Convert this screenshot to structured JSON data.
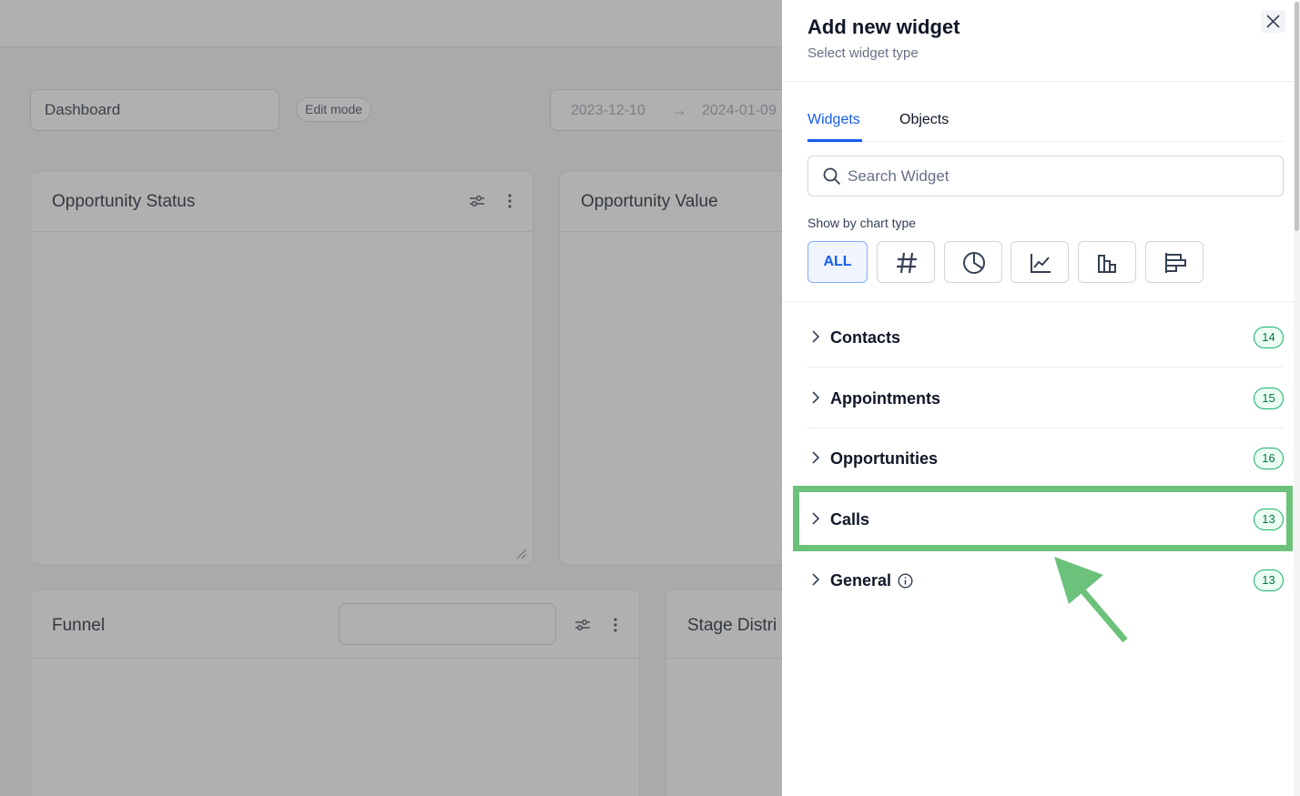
{
  "dashboard": {
    "name": "Dashboard",
    "edit_mode_label": "Edit mode",
    "date_start": "2023-12-10",
    "date_arrow": "→",
    "date_end": "2024-01-09",
    "cards": [
      {
        "title": "Opportunity Status"
      },
      {
        "title": "Opportunity Value"
      },
      {
        "title": "Funnel"
      },
      {
        "title": "Stage Distri"
      }
    ]
  },
  "panel": {
    "title": "Add new widget",
    "subtitle": "Select widget type",
    "tabs": [
      {
        "label": "Widgets",
        "active": true
      },
      {
        "label": "Objects",
        "active": false
      }
    ],
    "search_placeholder": "Search Widget",
    "chart_type_label": "Show by chart type",
    "chart_types": [
      {
        "label": "ALL",
        "icon": "all",
        "selected": true
      },
      {
        "icon": "hash-icon"
      },
      {
        "icon": "pie-chart-icon"
      },
      {
        "icon": "line-chart-icon"
      },
      {
        "icon": "bar-chart-icon"
      },
      {
        "icon": "horizontal-bar-chart-icon"
      }
    ],
    "categories": [
      {
        "label": "Contacts",
        "count": "14"
      },
      {
        "label": "Appointments",
        "count": "15"
      },
      {
        "label": "Opportunities",
        "count": "16"
      },
      {
        "label": "Calls",
        "count": "13"
      },
      {
        "label": "General",
        "count": "13"
      }
    ]
  },
  "colors": {
    "accent": "#155eef",
    "count_badge": "#17b26a",
    "highlight": "#6cc17b"
  }
}
